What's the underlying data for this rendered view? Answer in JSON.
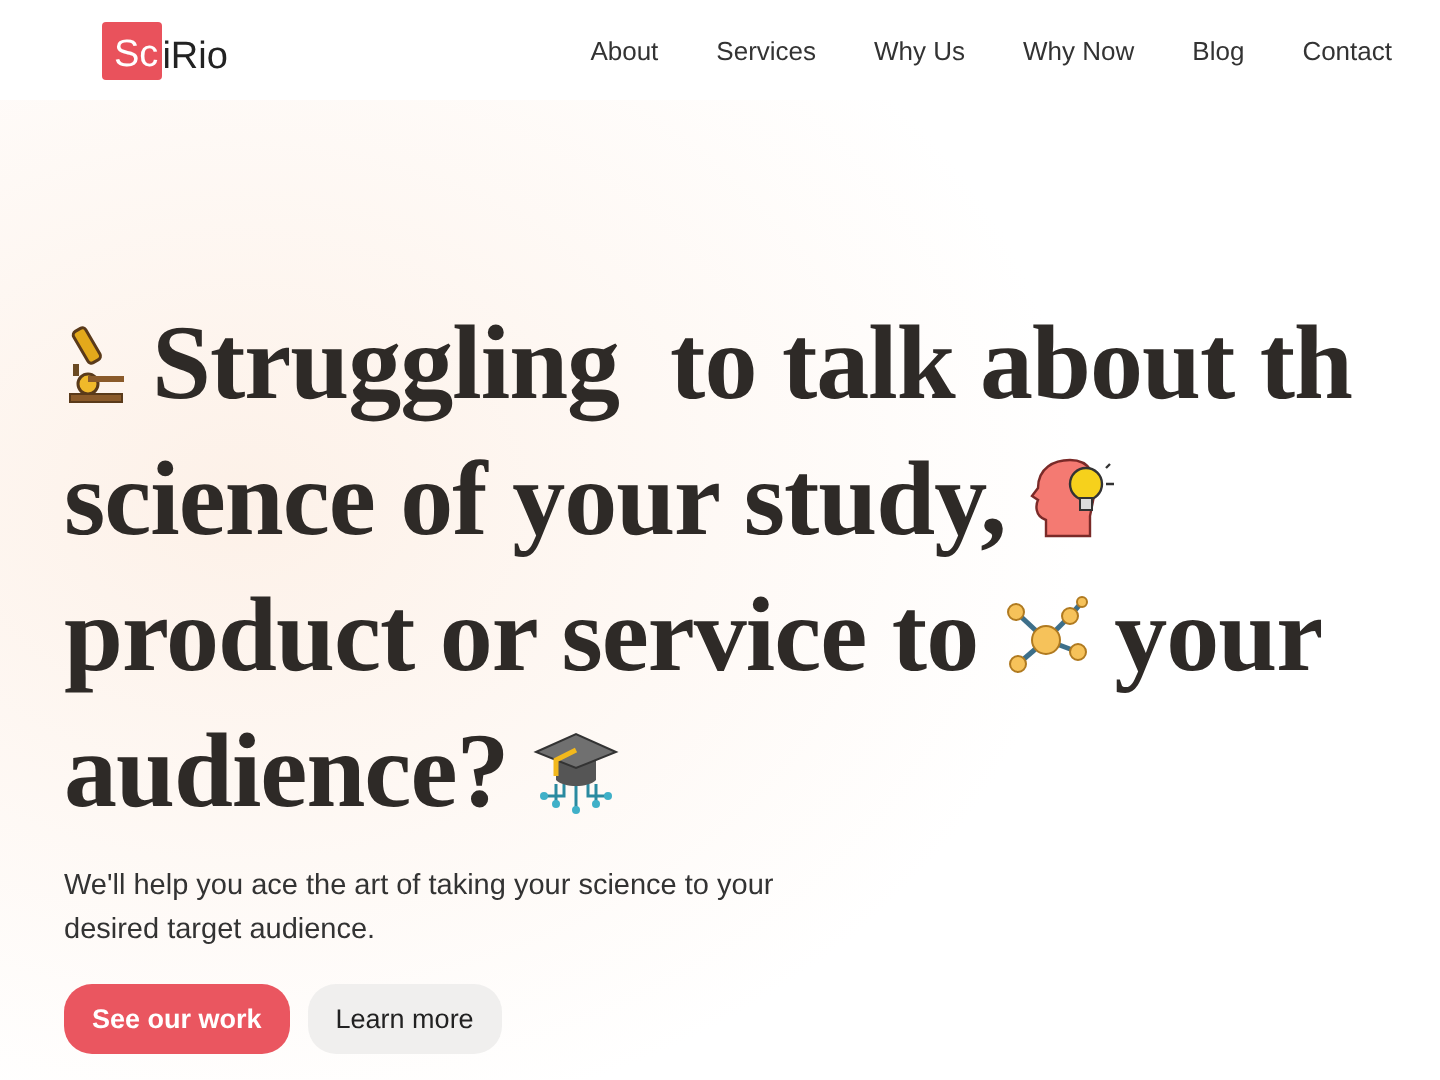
{
  "logo": {
    "mark": "Sc",
    "text": "iRio"
  },
  "nav": [
    "About",
    "Services",
    "Why Us",
    "Why Now",
    "Blog",
    "Contact"
  ],
  "headline": [
    [
      "Struggling  to talk about th"
    ],
    [
      "science of your study,"
    ],
    [
      "product or service to",
      "your"
    ],
    [
      "audience?"
    ]
  ],
  "subtitle": "We'll help you ace the art of taking your science to your desired target audience.",
  "buttons": [
    {
      "label": "See our work",
      "kind": "primary"
    },
    {
      "label": "Learn more",
      "kind": "secondary"
    }
  ]
}
